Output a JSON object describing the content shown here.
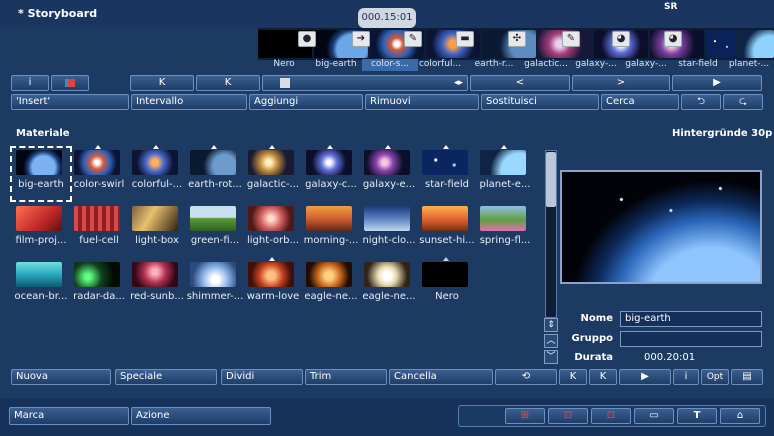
{
  "window": {
    "title": "* Storyboard",
    "badge": "SR"
  },
  "storyboard": {
    "timecode": "000.15:01",
    "items": [
      {
        "label": "Nero",
        "selected": false
      },
      {
        "label": "big-earth",
        "selected": false
      },
      {
        "label": "color-s...",
        "selected": true
      },
      {
        "label": "colorful...",
        "selected": false
      },
      {
        "label": "earth-r...",
        "selected": false
      },
      {
        "label": "galactic...",
        "selected": false
      },
      {
        "label": "galaxy-...",
        "selected": false
      },
      {
        "label": "galaxy-...",
        "selected": false
      },
      {
        "label": "star-field",
        "selected": false
      },
      {
        "label": "planet-...",
        "selected": false
      }
    ]
  },
  "nav": {
    "info": "i",
    "first": "K",
    "last": "K",
    "prev": "<",
    "next": ">",
    "play": "▶"
  },
  "toolbar": {
    "insert": "'Insert'",
    "intervallo": "Intervallo",
    "aggiungi": "Aggiungi",
    "rimuovi": "Rimuovi",
    "sostituisci": "Sostituisci",
    "cerca": "Cerca"
  },
  "material": {
    "title": "Materiale",
    "category": "Hintergründe 30p",
    "items": [
      "big-earth",
      "color-swirl",
      "colorful-...",
      "earth-rot...",
      "galactic-...",
      "galaxy-c...",
      "galaxy-e...",
      "star-field",
      "planet-e...",
      "film-proj...",
      "fuel-cell",
      "light-box",
      "green-fi...",
      "light-orb...",
      "morning-...",
      "night-clo...",
      "sunset-hi...",
      "spring-fl...",
      "ocean-br...",
      "radar-da...",
      "red-sunb...",
      "shimmer-...",
      "warm-love",
      "eagle-ne...",
      "eagle-ne...",
      "Nero"
    ]
  },
  "details": {
    "nome_label": "Nome",
    "nome_value": "big-earth",
    "gruppo_label": "Gruppo",
    "gruppo_value": "",
    "durata_label": "Durata",
    "durata_value": "000.20:01"
  },
  "bottom_toolbar": {
    "nuova": "Nuova",
    "speciale": "Speciale",
    "dividi": "Dividi",
    "trim": "Trim",
    "cancella": "Cancella",
    "info": "i",
    "opt": "Opt"
  },
  "footer": {
    "marca": "Marca",
    "azione": "Azione"
  },
  "colors": {
    "background": "#1c3a62",
    "selection": "#3b6aa8",
    "button_border": "#6b8fbf"
  }
}
